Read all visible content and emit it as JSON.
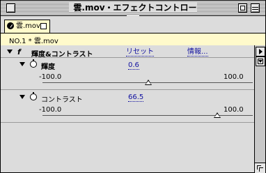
{
  "window": {
    "title": "雲.mov・エフェクトコントロール"
  },
  "tab": {
    "label": "雲.mov"
  },
  "header": {
    "text": "NO.1 * 雲.mov"
  },
  "effect": {
    "name": "輝度&コントラスト",
    "reset_label": "リセット",
    "info_label": "情報..."
  },
  "params": [
    {
      "name": "輝度",
      "value": "0.6",
      "min_label": "-100.0",
      "max_label": "100.0",
      "min": -100,
      "max": 100,
      "current": 0.6
    },
    {
      "name": "コントラスト",
      "value": "66.5",
      "min_label": "-100.0",
      "max_label": "100.0",
      "min": -100,
      "max": 100,
      "current": 66.5
    }
  ],
  "icons": {
    "close": "close-box-icon",
    "zoom": "zoom-box-icon",
    "collapse": "collapse-box-icon",
    "fx": "fx-icon",
    "stopwatch": "stopwatch-icon"
  },
  "colors": {
    "tab_bg": "#fffacb",
    "link": "#1010a0"
  }
}
